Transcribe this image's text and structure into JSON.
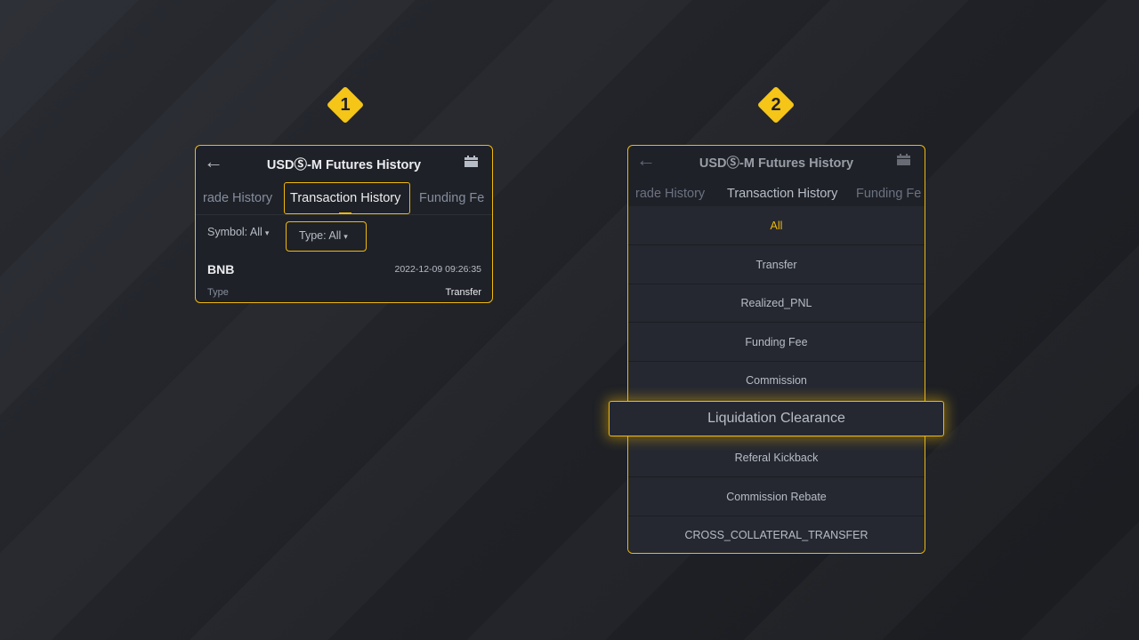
{
  "steps": [
    "1",
    "2"
  ],
  "panel1": {
    "title": "USDⓈ-M Futures History",
    "tabs": [
      "rade History",
      "Transaction History",
      "Funding Fe"
    ],
    "symbol_filter": "Symbol: All",
    "type_filter": "Type: All",
    "caret": "▾",
    "record": {
      "asset": "BNB",
      "timestamp": "2022-12-09 09:26:35",
      "type_label": "Type",
      "type_value": "Transfer"
    }
  },
  "panel2": {
    "title": "USDⓈ-M Futures History",
    "tabs": [
      "rade History",
      "Transaction History",
      "Funding Fe"
    ],
    "options": [
      "All",
      "Transfer",
      "Realized_PNL",
      "Funding Fee",
      "Commission",
      "Liquidation Clearance",
      "Referal Kickback",
      "Commission Rebate",
      "CROSS_COLLATERAL_TRANSFER"
    ],
    "selected_option": "All",
    "highlighted_option": "Liquidation Clearance"
  },
  "icons": {
    "back": "←",
    "calendar": "calendar-icon"
  },
  "colors": {
    "accent": "#f0b90b",
    "panel_bg": "#1f2128",
    "text": "#eaecef",
    "muted": "#848e9c"
  }
}
